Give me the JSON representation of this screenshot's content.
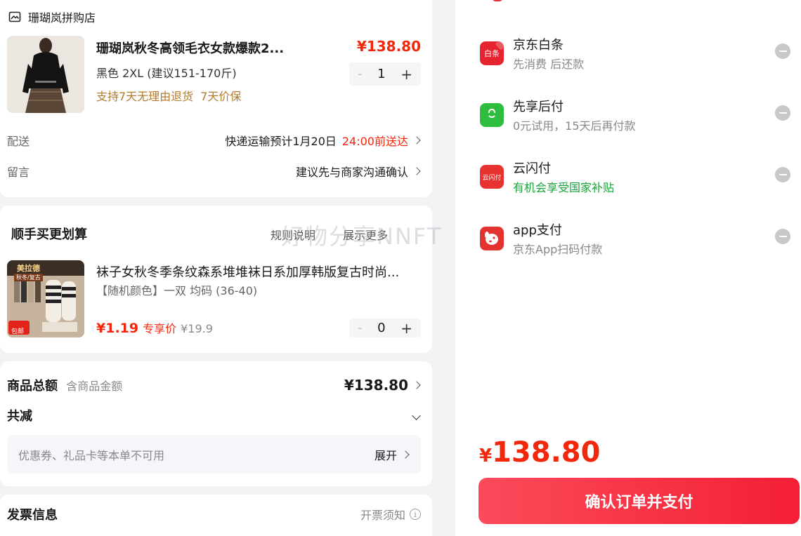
{
  "order": {
    "shop_name": "珊瑚岚拼购店",
    "product_title": "珊瑚岚秋冬高领毛衣女款爆款2...",
    "price": "¥138.80",
    "spec": "黑色   2XL (建议151-170斤)",
    "guarantee_1": "支持7天无理由退货",
    "guarantee_2": "7天价保",
    "quantity": "1",
    "minus": "-",
    "plus": "+",
    "delivery_label": "配送",
    "delivery_value": "快递运输预计1月20日",
    "delivery_time": "24:00前送达",
    "message_label": "留言",
    "message_value": "建议先与商家沟通确认"
  },
  "bundle": {
    "title": "顺手买更划算",
    "rules": "规则说明",
    "show_more": "展示更多",
    "watermark": "好物分享NNFT",
    "item_title": "袜子女秋冬季条纹森系堆堆袜日系加厚韩版复古时尚...",
    "item_spec": "【随机颜色】一双 均码   (36-40)",
    "item_price": "¥1.19",
    "item_exclusive": "专享价",
    "item_orig": "¥19.9",
    "item_quantity": "0",
    "thumb_tag_1": "美拉德",
    "thumb_tag_2": "秋冬/复古",
    "thumb_tag_3": "包邮"
  },
  "totals": {
    "goods_total_label": "商品总额",
    "goods_total_sub": "含商品金额",
    "goods_total_value": "¥138.80",
    "reduce_label": "共减",
    "coupon_text": "优惠券、礼品卡等本单不可用",
    "expand": "展开"
  },
  "invoice": {
    "title": "发票信息",
    "note": "开票须知"
  },
  "payment": {
    "methods": [
      {
        "name": "京东白条",
        "desc": "先消费 后还款",
        "icon": "baitiao-icon",
        "icon_text": "白条"
      },
      {
        "name": "先享后付",
        "desc": "0元试用，15天后再付款",
        "icon": "shopping-bag-icon",
        "icon_text": ""
      },
      {
        "name": "云闪付",
        "desc": "有机会享受国家补贴",
        "icon": "unionpay-icon",
        "icon_text": "云闪付"
      },
      {
        "name": "app支付",
        "desc": "京东App扫码付款",
        "icon": "jd-dog-icon",
        "icon_text": ""
      }
    ],
    "total": "138.80",
    "currency": "¥",
    "confirm_label": "确认订单并支付"
  },
  "colors": {
    "accent_red": "#f2270c",
    "gold": "#b27a2c",
    "green": "#1aa33a"
  }
}
